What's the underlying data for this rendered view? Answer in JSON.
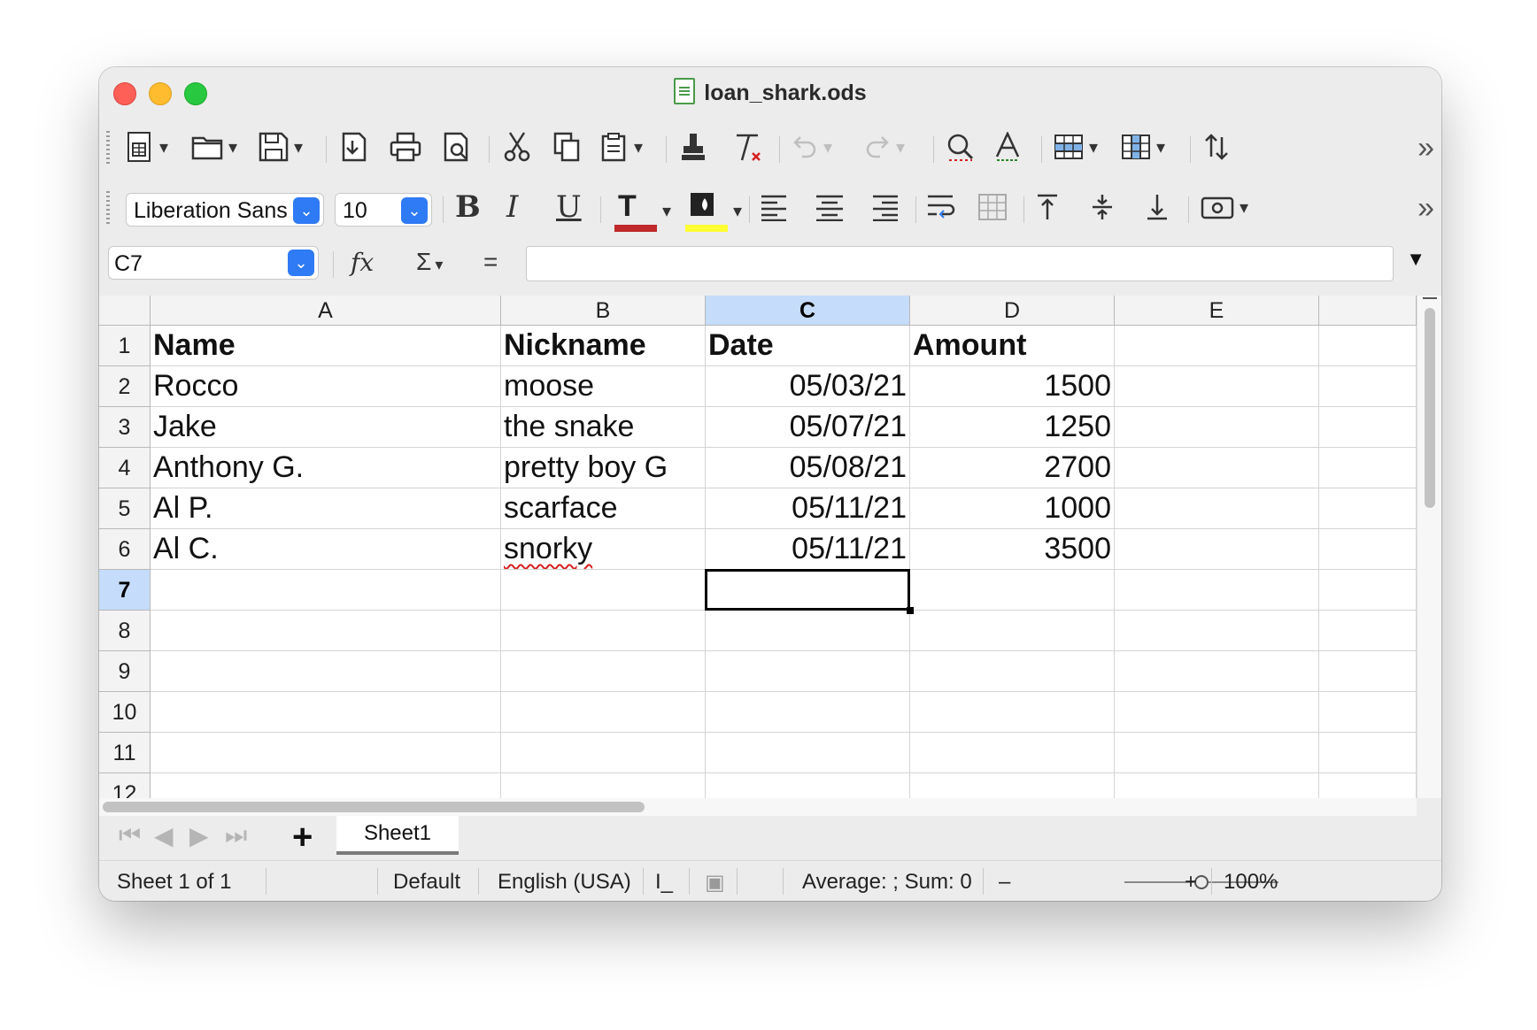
{
  "window": {
    "title": "loan_shark.ods"
  },
  "toolbar_standard": {
    "icons": [
      "new-spreadsheet-icon",
      "open-folder-icon",
      "save-icon",
      "export-pdf-icon",
      "print-icon",
      "print-preview-icon",
      "cut-icon",
      "copy-icon",
      "paste-icon",
      "clone-formatting-icon",
      "clear-formatting-icon",
      "undo-icon",
      "redo-icon",
      "find-replace-icon",
      "spelling-icon",
      "row-icon",
      "column-icon",
      "sort-icon"
    ],
    "more": "»"
  },
  "toolbar_format": {
    "font_name": "Liberation Sans",
    "font_size": "10",
    "bold": "B",
    "italic": "I",
    "underline": "U",
    "font_color_glyph": "T",
    "font_color": "#c0282a",
    "highlight_color": "#ffff33",
    "more": "»"
  },
  "formula_bar": {
    "name_box": "C7",
    "function_wizard": "fx",
    "sum": "Σ",
    "equals": "=",
    "content": ""
  },
  "sheet": {
    "columns": [
      "A",
      "B",
      "C",
      "D",
      "E"
    ],
    "selected_column": "C",
    "rows": [
      "1",
      "2",
      "3",
      "4",
      "5",
      "6",
      "7",
      "8",
      "9",
      "10",
      "11",
      "12"
    ],
    "selected_row": "7",
    "header": [
      "Name",
      "Nickname",
      "Date",
      "Amount"
    ],
    "data": [
      [
        "Rocco",
        "moose",
        "05/03/21",
        "1500"
      ],
      [
        "Jake",
        "the snake",
        "05/07/21",
        "1250"
      ],
      [
        "Anthony G.",
        "pretty boy G",
        "05/08/21",
        "2700"
      ],
      [
        "Al P.",
        "scarface",
        "05/11/21",
        "1000"
      ],
      [
        "Al C.",
        "snorky",
        "05/11/21",
        "3500"
      ]
    ],
    "active_cell": "C7"
  },
  "sheet_tabs": {
    "tabs": [
      "Sheet1"
    ],
    "add": "+"
  },
  "status_bar": {
    "sheet_info": "Sheet 1 of 1",
    "page_style": "Default",
    "language": "English (USA)",
    "selection_mode": "I_",
    "summary": "Average: ; Sum: 0",
    "zoom_minus": "–",
    "zoom_plus": "+",
    "zoom": "100%",
    "zoom_level": 0.5
  }
}
